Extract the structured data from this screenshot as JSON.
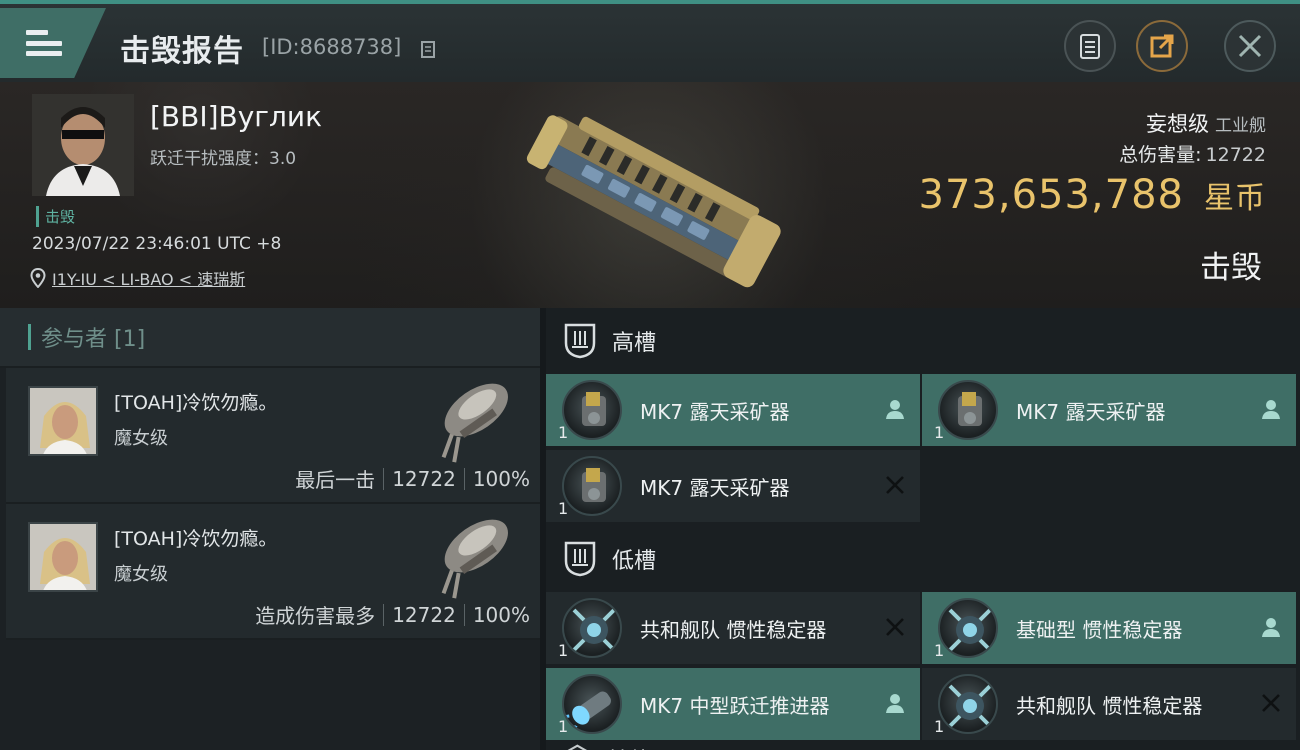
{
  "header": {
    "title": "击毁报告",
    "report_id": "[ID:8688738]"
  },
  "victim": {
    "name": "[BBI]Вуглик",
    "warp_scramble": "跃迁干扰强度：3.0",
    "tag": "击毁",
    "timestamp": "2023/07/22 23:46:01 UTC +8",
    "location": "I1Y-IU < LI-BAO < 速瑞斯",
    "ship_name": "妄想级",
    "ship_type": "工业舰",
    "total_damage_label": "总伤害量:",
    "total_damage": "12722",
    "isk_value": "373,653,788",
    "currency": "星币",
    "status": "击毁"
  },
  "participants": {
    "header": "参与者 [1]",
    "items": [
      {
        "name": "[TOAH]冷饮勿瘾。",
        "ship": "魔女级",
        "role": "最后一击",
        "damage": "12722",
        "percent": "100%"
      },
      {
        "name": "[TOAH]冷饮勿瘾。",
        "ship": "魔女级",
        "role": "造成伤害最多",
        "damage": "12722",
        "percent": "100%"
      }
    ]
  },
  "fitting": {
    "high_slot_label": "高槽",
    "low_slot_label": "低槽",
    "next_slot_label": "其他",
    "high": [
      {
        "name": "MK7 露天采矿器",
        "qty": "1",
        "state": "dropped",
        "icon": "strip-miner-icon"
      },
      {
        "name": "MK7 露天采矿器",
        "qty": "1",
        "state": "dropped",
        "icon": "strip-miner-icon"
      },
      {
        "name": "MK7 露天采矿器",
        "qty": "1",
        "state": "destroyed",
        "icon": "strip-miner-icon"
      }
    ],
    "low": [
      {
        "name": "共和舰队 惯性稳定器",
        "qty": "1",
        "state": "destroyed",
        "icon": "inertial-stabilizer-icon"
      },
      {
        "name": "基础型 惯性稳定器",
        "qty": "1",
        "state": "dropped",
        "icon": "inertial-stabilizer-icon"
      },
      {
        "name": "MK7 中型跃迁推进器",
        "qty": "1",
        "state": "dropped",
        "icon": "microwarp-drive-icon"
      },
      {
        "name": "共和舰队 惯性稳定器",
        "qty": "1",
        "state": "destroyed",
        "icon": "inertial-stabilizer-icon"
      }
    ]
  },
  "colors": {
    "accent": "#3f8f83",
    "dropped_bg": "#3f6e66",
    "destroyed_bg": "#232a2d",
    "isk": "#e9c36b"
  }
}
